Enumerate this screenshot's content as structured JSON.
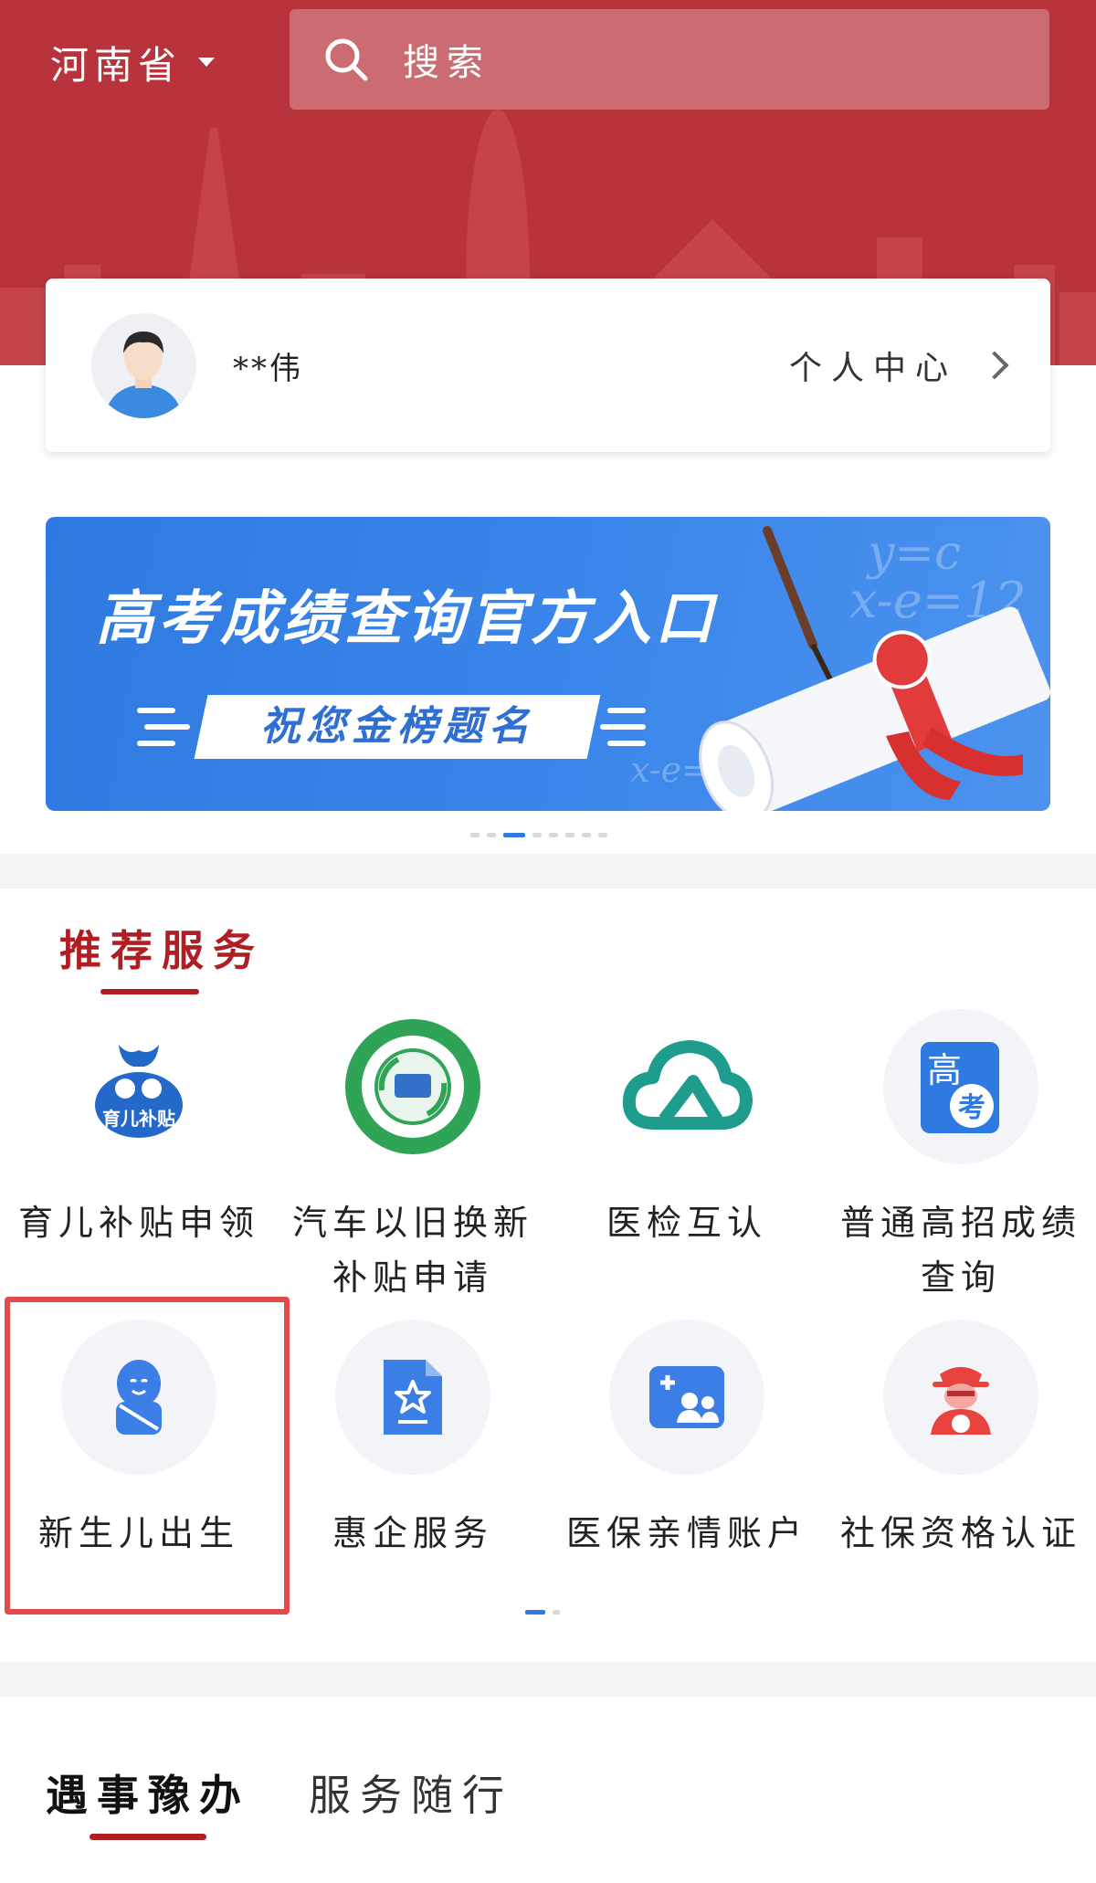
{
  "header": {
    "province": "河南省",
    "search_placeholder": "搜索"
  },
  "user": {
    "name": "**伟",
    "personal_center": "个人中心"
  },
  "banner": {
    "title": "高考成绩查询官方入口",
    "subtitle": "祝您金榜题名",
    "math_1": "y=c",
    "math_2": "x-e=12",
    "math_3": "x-e=",
    "carousel_count": 8,
    "carousel_active": 3
  },
  "recommended": {
    "title": "推荐服务",
    "items": [
      {
        "label": "育儿补贴申领",
        "icon": "childcare-subsidy-icon"
      },
      {
        "label": "汽车以旧换新补贴申请",
        "icon": "trade-in-icon"
      },
      {
        "label": "医检互认",
        "icon": "medical-cloud-icon"
      },
      {
        "label": "普通高招成绩查询",
        "icon": "gaokao-icon"
      },
      {
        "label": "新生儿出生",
        "icon": "baby-icon"
      },
      {
        "label": "惠企服务",
        "icon": "enterprise-doc-icon"
      },
      {
        "label": "医保亲情账户",
        "icon": "family-account-icon"
      },
      {
        "label": "社保资格认证",
        "icon": "social-security-icon"
      }
    ],
    "badge_text": "育儿补贴",
    "gaokao_icon_text_1": "高",
    "gaokao_icon_text_2": "考"
  },
  "tabs": [
    {
      "label": "遇事豫办",
      "active": true
    },
    {
      "label": "服务随行",
      "active": false
    }
  ],
  "colors": {
    "header_red": "#b8333c",
    "accent_red": "#b01e23",
    "brand_blue": "#2f7ae0",
    "highlight_border": "#e34a4a"
  }
}
